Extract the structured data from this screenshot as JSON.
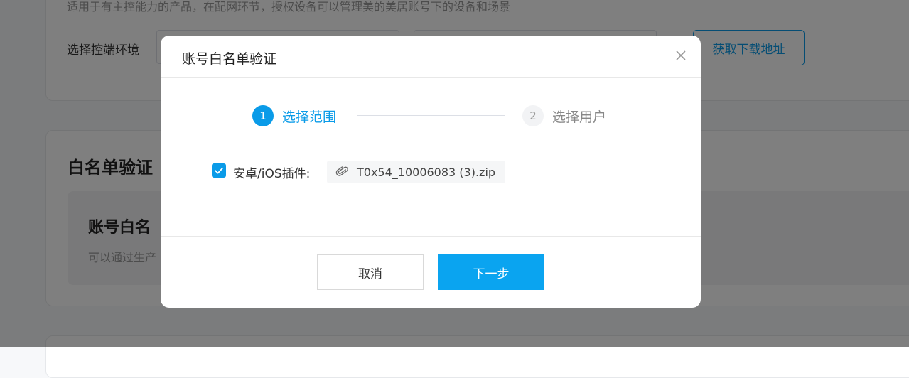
{
  "background": {
    "description": "适用于有主控能力的产品，在配网环节，授权设备可以管理美的美居账号下的设备和场景",
    "env_label": "选择控端环境",
    "download_button": "获取下载地址",
    "section_title": "白名单验证",
    "inner_title": "账号白名",
    "inner_desc": "可以通过生产"
  },
  "modal": {
    "title": "账号白名单验证",
    "steps": [
      {
        "number": "1",
        "label": "选择范围",
        "state": "active"
      },
      {
        "number": "2",
        "label": "选择用户",
        "state": "inactive"
      }
    ],
    "plugin": {
      "checked": true,
      "label": "安卓/iOS插件:",
      "file_name": "T0x54_10006083 (3).zip"
    },
    "footer": {
      "cancel_label": "取消",
      "next_label": "下一步"
    }
  },
  "colors": {
    "accent": "#0a9be8",
    "primary_button": "#0aa4f0",
    "overlay": "rgba(0,0,0,0.5)"
  },
  "icons": {
    "close": "close-icon",
    "check": "check-icon",
    "attachment": "paperclip-icon"
  }
}
